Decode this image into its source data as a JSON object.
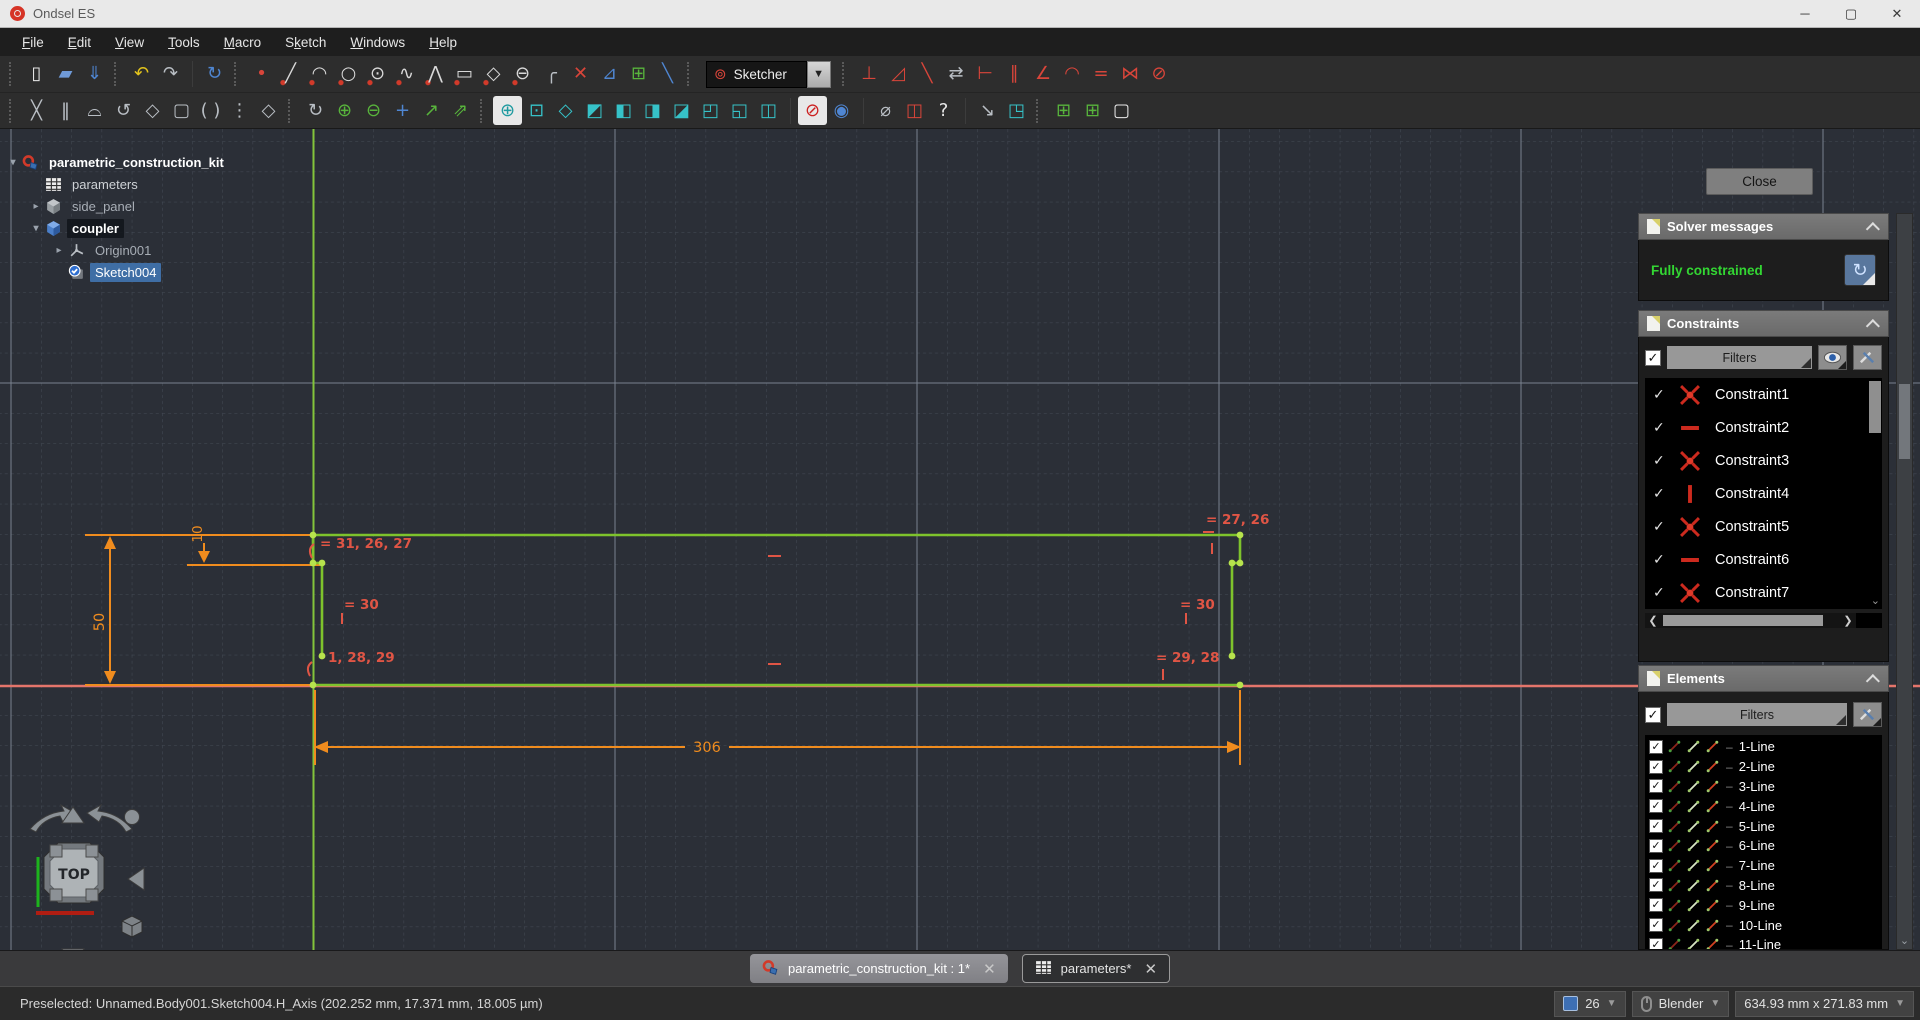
{
  "window": {
    "title": "Ondsel ES",
    "minimize": "─",
    "maximize": "▢",
    "close": "✕"
  },
  "menu": {
    "items": [
      {
        "label": "File",
        "u": 0
      },
      {
        "label": "Edit",
        "u": 0
      },
      {
        "label": "View",
        "u": 0
      },
      {
        "label": "Tools",
        "u": 0
      },
      {
        "label": "Macro",
        "u": 0
      },
      {
        "label": "Sketch",
        "u": 1
      },
      {
        "label": "Windows",
        "u": 0
      },
      {
        "label": "Help",
        "u": 0
      }
    ]
  },
  "toolbar1": {
    "dropdown": {
      "value": "Sketcher"
    },
    "items": [
      {
        "t": "grip"
      },
      {
        "t": "i",
        "n": "new-document",
        "g": "▯",
        "c": "w"
      },
      {
        "t": "i",
        "n": "open-folder",
        "g": "▰",
        "c": "folder"
      },
      {
        "t": "i",
        "n": "save",
        "g": "⇓",
        "c": "blue"
      },
      {
        "t": "grip"
      },
      {
        "t": "i",
        "n": "undo",
        "g": "↶",
        "c": "yellow"
      },
      {
        "t": "i",
        "n": "redo",
        "g": "↷",
        "c": "silver"
      },
      {
        "t": "sep"
      },
      {
        "t": "i",
        "n": "refresh",
        "g": "↻",
        "c": "blue"
      },
      {
        "t": "grip"
      },
      {
        "t": "i",
        "n": "create-point",
        "g": "•",
        "c": "red"
      },
      {
        "t": "i",
        "n": "create-line",
        "g": "╱",
        "c": "sketch"
      },
      {
        "t": "i",
        "n": "create-arc",
        "g": "◠",
        "c": "sketch"
      },
      {
        "t": "i",
        "n": "create-circle",
        "g": "○",
        "c": "sketch"
      },
      {
        "t": "i",
        "n": "create-ellipse",
        "g": "⊙",
        "c": "sketch"
      },
      {
        "t": "i",
        "n": "create-bspline",
        "g": "∿",
        "c": "sketch"
      },
      {
        "t": "i",
        "n": "create-polyline",
        "g": "⋀",
        "c": "sketch"
      },
      {
        "t": "i",
        "n": "create-rectangle",
        "g": "▭",
        "c": "sketch"
      },
      {
        "t": "i",
        "n": "create-polygon",
        "g": "◇",
        "c": "sketch"
      },
      {
        "t": "i",
        "n": "create-slot",
        "g": "⊖",
        "c": "sketch"
      },
      {
        "t": "i",
        "n": "create-fillet",
        "g": "╭",
        "c": "silver"
      },
      {
        "t": "i",
        "n": "trim-edge",
        "g": "✕",
        "c": "red"
      },
      {
        "t": "i",
        "n": "extend-edge",
        "g": "⊿",
        "c": "blue"
      },
      {
        "t": "i",
        "n": "external-geometry",
        "g": "⊞",
        "c": "green"
      },
      {
        "t": "i",
        "n": "toggle-construction-geometry",
        "g": "╲",
        "c": "blue"
      },
      {
        "t": "grip"
      },
      {
        "t": "dropdown"
      },
      {
        "t": "grip"
      },
      {
        "t": "i",
        "n": "constrain-vertical",
        "g": "⊥",
        "c": "red"
      },
      {
        "t": "i",
        "n": "constrain-angle",
        "g": "◿",
        "c": "red"
      },
      {
        "t": "i",
        "n": "constrain-distance",
        "g": "╲",
        "c": "red"
      },
      {
        "t": "i",
        "n": "constrain-distance-x",
        "g": "⇄",
        "c": "silver"
      },
      {
        "t": "i",
        "n": "constrain-distance-y",
        "g": "⊢",
        "c": "red"
      },
      {
        "t": "i",
        "n": "constrain-parallel",
        "g": "∥",
        "c": "red"
      },
      {
        "t": "i",
        "n": "constrain-perpendicular",
        "g": "∠",
        "c": "red"
      },
      {
        "t": "i",
        "n": "constrain-tangent",
        "g": "◠",
        "c": "red"
      },
      {
        "t": "i",
        "n": "constrain-equal",
        "g": "=",
        "c": "red"
      },
      {
        "t": "i",
        "n": "constrain-symmetric",
        "g": "⋈",
        "c": "red"
      },
      {
        "t": "i",
        "n": "constrain-block",
        "g": "⊘",
        "c": "red"
      }
    ]
  },
  "toolbar2": {
    "items": [
      {
        "t": "grip"
      },
      {
        "t": "i",
        "n": "modify-geometry",
        "g": "╳",
        "c": "silver"
      },
      {
        "t": "i",
        "n": "split-edge",
        "g": "‖",
        "c": "silver"
      },
      {
        "t": "i",
        "n": "edit-arc",
        "g": "⌓",
        "c": "silver"
      },
      {
        "t": "i",
        "n": "rotate-geometry",
        "g": "↺",
        "c": "silver"
      },
      {
        "t": "i",
        "n": "polar-pattern",
        "g": "◇",
        "c": "silver"
      },
      {
        "t": "i",
        "n": "rectangular-selection",
        "g": "▢",
        "c": "silver"
      },
      {
        "t": "i",
        "n": "symmetry-tool",
        "g": "( )",
        "c": "silver"
      },
      {
        "t": "i",
        "n": "evaluate-sketch",
        "g": "⋮",
        "c": "silver"
      },
      {
        "t": "i",
        "n": "carbon-copy",
        "g": "◇",
        "c": "silver"
      },
      {
        "t": "grip"
      },
      {
        "t": "i",
        "n": "convert-to-nurbs",
        "g": "↻",
        "c": "silver"
      },
      {
        "t": "i",
        "n": "increase-bspline-degree",
        "g": "⊕",
        "c": "green"
      },
      {
        "t": "i",
        "n": "decrease-bspline-degree",
        "g": "⊖",
        "c": "green"
      },
      {
        "t": "i",
        "n": "show-control-polygon",
        "g": "+",
        "c": "blue"
      },
      {
        "t": "i",
        "n": "insert-knot",
        "g": "↗",
        "c": "green"
      },
      {
        "t": "i",
        "n": "join-curves",
        "g": "⇗",
        "c": "green"
      },
      {
        "t": "grip"
      },
      {
        "t": "i",
        "n": "zoom-in",
        "g": "⊕",
        "c": "teal-lt"
      },
      {
        "t": "i",
        "n": "fit-all",
        "g": "⊡",
        "c": "teal"
      },
      {
        "t": "i",
        "n": "draw-style",
        "g": "◇",
        "c": "teal"
      },
      {
        "t": "i",
        "n": "view-isometric",
        "g": "◩",
        "c": "teal"
      },
      {
        "t": "i",
        "n": "view-front",
        "g": "◧",
        "c": "teal"
      },
      {
        "t": "i",
        "n": "view-top",
        "g": "◨",
        "c": "teal"
      },
      {
        "t": "i",
        "n": "view-right",
        "g": "◪",
        "c": "teal"
      },
      {
        "t": "i",
        "n": "view-rear",
        "g": "◰",
        "c": "teal"
      },
      {
        "t": "i",
        "n": "view-bottom",
        "g": "◱",
        "c": "teal"
      },
      {
        "t": "i",
        "n": "view-left",
        "g": "◫",
        "c": "teal"
      },
      {
        "t": "sep"
      },
      {
        "t": "i",
        "n": "stop-operation",
        "g": "⊘",
        "c": "red-lt"
      },
      {
        "t": "i",
        "n": "toggle-render",
        "g": "◉",
        "c": "blue"
      },
      {
        "t": "sep"
      },
      {
        "t": "i",
        "n": "measure",
        "g": "⌀",
        "c": "silver"
      },
      {
        "t": "i",
        "n": "clipping-plane",
        "g": "◫",
        "c": "red"
      },
      {
        "t": "i",
        "n": "whats-this",
        "g": "?",
        "c": "w"
      },
      {
        "t": "sep"
      },
      {
        "t": "i",
        "n": "import-links",
        "g": "↘",
        "c": "silver"
      },
      {
        "t": "i",
        "n": "make-link",
        "g": "◳",
        "c": "teal"
      },
      {
        "t": "grip"
      },
      {
        "t": "i",
        "n": "toggle-grid",
        "g": "⊞",
        "c": "green"
      },
      {
        "t": "i",
        "n": "toggle-snap",
        "g": "⊞",
        "c": "green"
      },
      {
        "t": "i",
        "n": "render-frame",
        "g": "▢",
        "c": "w"
      }
    ]
  },
  "tree": {
    "items": [
      {
        "label": "parametric_construction_kit",
        "level": 0,
        "exp": "v",
        "icon": "freecad-doc",
        "bold": true
      },
      {
        "label": "parameters",
        "level": 1,
        "exp": "",
        "icon": "spreadsheet",
        "dim": false
      },
      {
        "label": "side_panel",
        "level": 1,
        "exp": ">",
        "icon": "body-gray",
        "dim": true
      },
      {
        "label": "coupler",
        "level": 1,
        "exp": "v",
        "icon": "body-blue",
        "bold": true,
        "hl": true
      },
      {
        "label": "Origin001",
        "level": 2,
        "exp": ">",
        "icon": "origin",
        "dim": true
      },
      {
        "label": "Sketch004",
        "level": 2,
        "exp": "",
        "icon": "sketch-edit",
        "selected": true
      }
    ]
  },
  "viewport": {
    "close_label": "Close",
    "nav_cube_label": "TOP"
  },
  "sketch": {
    "labels": {
      "top_left": "= 31, 26, 27",
      "mid_left": "= 30",
      "bottom_left": "1, 28, 29",
      "top_right": "= 27, 26",
      "mid_right": "= 30",
      "bottom_right": "= 29, 28",
      "dim_width": "306",
      "dim_height": "50",
      "dim_step": "10"
    },
    "colors": {
      "geometry_green": "#7ec32c",
      "axis_vertical": "#83c43b",
      "axis_horizontal_preselected": "#e4756b",
      "dimension_orange": "#f08c1e",
      "constraint_red": "#e05545"
    }
  },
  "panels": {
    "solver": {
      "title": "Solver messages",
      "status": "Fully constrained"
    },
    "constraints": {
      "title": "Constraints",
      "filters_label": "Filters",
      "items": [
        {
          "label": "Constraint1",
          "icon": "coincident"
        },
        {
          "label": "Constraint2",
          "icon": "horizontal"
        },
        {
          "label": "Constraint3",
          "icon": "coincident"
        },
        {
          "label": "Constraint4",
          "icon": "vertical"
        },
        {
          "label": "Constraint5",
          "icon": "coincident"
        },
        {
          "label": "Constraint6",
          "icon": "horizontal"
        },
        {
          "label": "Constraint7",
          "icon": "coincident"
        }
      ]
    },
    "elements": {
      "title": "Elements",
      "filters_label": "Filters",
      "items": [
        "1-Line",
        "2-Line",
        "3-Line",
        "4-Line",
        "5-Line",
        "6-Line",
        "7-Line",
        "8-Line",
        "9-Line",
        "10-Line",
        "11-Line"
      ]
    }
  },
  "tabs": {
    "items": [
      {
        "label": "parametric_construction_kit : 1*",
        "icon": "freecad-doc",
        "active": true
      },
      {
        "label": "parameters*",
        "icon": "spreadsheet",
        "active": false
      }
    ]
  },
  "statusbar": {
    "message": "Preselected: Unnamed.Body001.Sketch004.H_Axis (202.252 mm, 17.371 mm, 18.005 µm)",
    "grid_size": "26",
    "nav_style": "Blender",
    "view_dimensions": "634.93 mm x 271.83 mm"
  }
}
